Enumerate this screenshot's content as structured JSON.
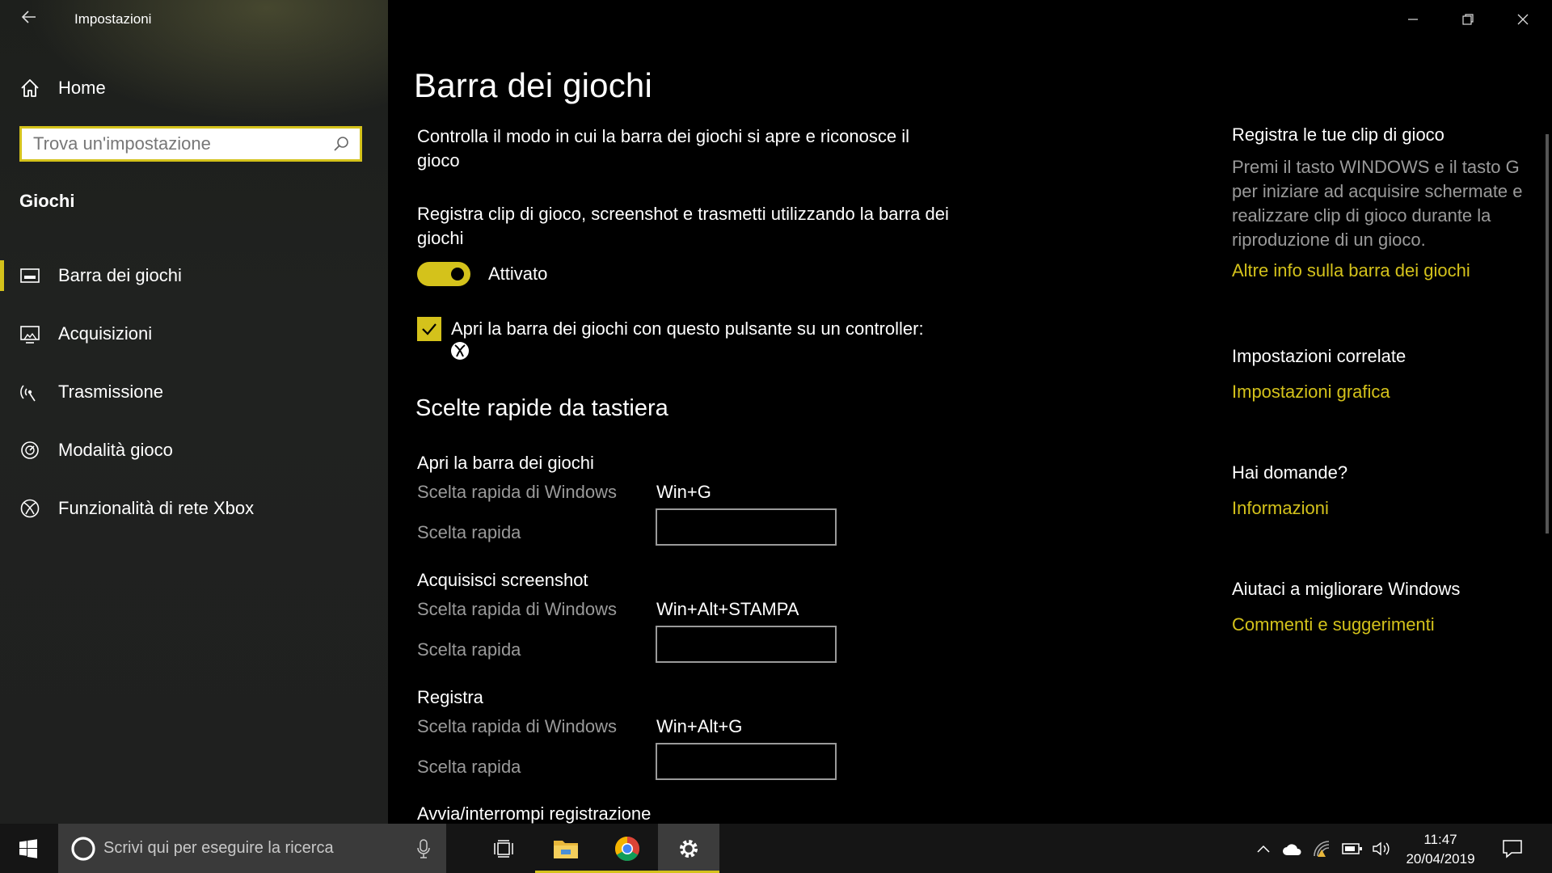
{
  "window": {
    "title": "Impostazioni"
  },
  "sidebar": {
    "home_label": "Home",
    "search_placeholder": "Trova un'impostazione",
    "section_label": "Giochi",
    "items": [
      {
        "label": "Barra dei giochi",
        "icon": "game-bar-icon",
        "active": true
      },
      {
        "label": "Acquisizioni",
        "icon": "captures-icon",
        "active": false
      },
      {
        "label": "Trasmissione",
        "icon": "broadcast-icon",
        "active": false
      },
      {
        "label": "Modalità gioco",
        "icon": "game-mode-icon",
        "active": false
      },
      {
        "label": "Funzionalità di rete Xbox",
        "icon": "xbox-icon",
        "active": false
      }
    ]
  },
  "main": {
    "title": "Barra dei giochi",
    "description": "Controlla il modo in cui la barra dei giochi si apre e riconosce il gioco",
    "record_description": "Registra clip di gioco, screenshot e trasmetti utilizzando la barra dei giochi",
    "toggle": {
      "state_label": "Attivato",
      "on": true
    },
    "controller_checkbox": {
      "label": "Apri la barra dei giochi con questo pulsante su un controller:",
      "checked": true
    },
    "shortcuts_title": "Scelte rapide da tastiera",
    "shortcut_key_label": "Scelta rapida di Windows",
    "shortcut_custom_label": "Scelta rapida",
    "shortcuts": [
      {
        "title": "Apri la barra dei giochi",
        "windows_shortcut": "Win+G",
        "custom": ""
      },
      {
        "title": "Acquisisci screenshot",
        "windows_shortcut": "Win+Alt+STAMPA",
        "custom": ""
      },
      {
        "title": "Registra",
        "windows_shortcut": "Win+Alt+G",
        "custom": ""
      },
      {
        "title": "Avvia/interrompi registrazione"
      }
    ]
  },
  "right": {
    "clips": {
      "heading": "Registra le tue clip di gioco",
      "text": "Premi il tasto WINDOWS e il tasto G per iniziare ad acquisire schermate e realizzare clip di gioco durante la riproduzione di un gioco.",
      "link": "Altre info sulla barra dei giochi"
    },
    "related": {
      "heading": "Impostazioni correlate",
      "link": "Impostazioni grafica"
    },
    "questions": {
      "heading": "Hai domande?",
      "link": "Informazioni"
    },
    "improve": {
      "heading": "Aiutaci a migliorare Windows",
      "link": "Commenti e suggerimenti"
    }
  },
  "taskbar": {
    "search_placeholder": "Scrivi qui per eseguire la ricerca",
    "time": "11:47",
    "date": "20/04/2019"
  },
  "colors": {
    "accent": "#d4c21b",
    "background": "#000000",
    "sidebar": "#1f201f",
    "secondary_text": "#9a9a9a"
  }
}
